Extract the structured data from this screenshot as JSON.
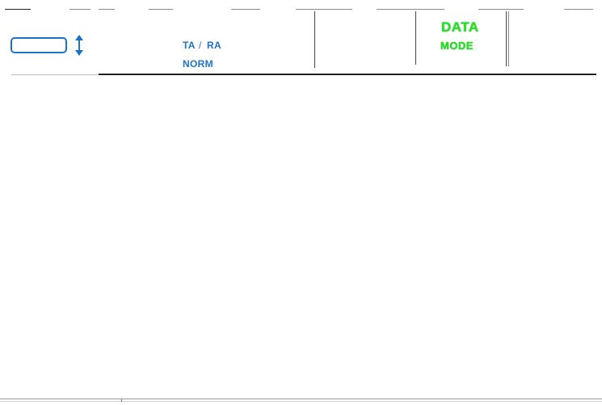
{
  "header": {
    "squawk_code": "",
    "transponder_mode": "TA",
    "transponder_separator": "/",
    "transponder_mode_alt": "RA",
    "display_mode": "NORM",
    "data_label": "DATA",
    "mode_label": "MODE"
  },
  "colors": {
    "accent_blue": "#1b73c8",
    "status_green": "#1fe61f"
  },
  "icons": {
    "squawk_adjust": "up-down-arrow-icon"
  }
}
